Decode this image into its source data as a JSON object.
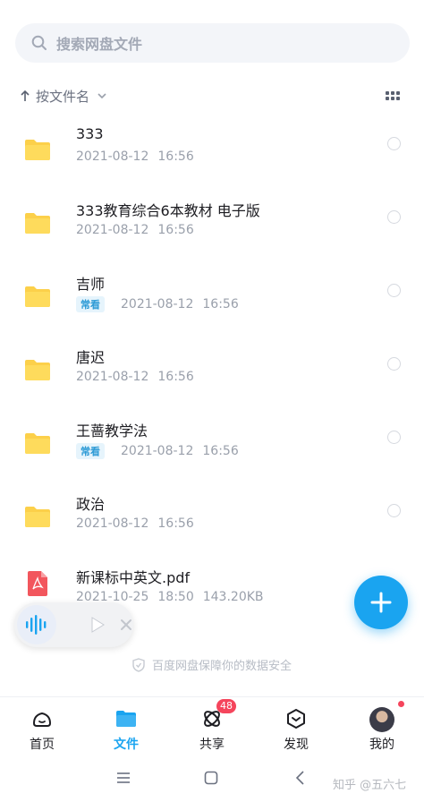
{
  "search": {
    "placeholder": "搜索网盘文件",
    "icon": "search-icon"
  },
  "sort": {
    "label": "按文件名"
  },
  "files": [
    {
      "name": "333",
      "badge": "",
      "date": "2021-08-12",
      "time": "16:56",
      "size": "",
      "type": "folder"
    },
    {
      "name": "333教育综合6本教材 电子版",
      "badge": "",
      "date": "2021-08-12",
      "time": "16:56",
      "size": "",
      "type": "folder"
    },
    {
      "name": "吉师",
      "badge": "常看",
      "date": "2021-08-12",
      "time": "16:56",
      "size": "",
      "type": "folder"
    },
    {
      "name": "唐迟",
      "badge": "",
      "date": "2021-08-12",
      "time": "16:56",
      "size": "",
      "type": "folder"
    },
    {
      "name": "王蔷教学法",
      "badge": "常看",
      "date": "2021-08-12",
      "time": "16:56",
      "size": "",
      "type": "folder"
    },
    {
      "name": "政治",
      "badge": "",
      "date": "2021-08-12",
      "time": "16:56",
      "size": "",
      "type": "folder"
    },
    {
      "name": "新课标中英文.pdf",
      "badge": "",
      "date": "2021-10-25",
      "time": "18:50",
      "size": "143.20KB",
      "type": "pdf"
    }
  ],
  "safety_notice": "百度网盘保障你的数据安全",
  "tabs": [
    {
      "label": "首页",
      "icon": "home-icon"
    },
    {
      "label": "文件",
      "icon": "folder-icon"
    },
    {
      "label": "共享",
      "icon": "share-icon",
      "count": "48"
    },
    {
      "label": "发现",
      "icon": "discover-icon"
    },
    {
      "label": "我的",
      "icon": "avatar"
    }
  ],
  "watermark": "知乎 @五六七",
  "colors": {
    "accent": "#1aa4f0",
    "folder": "#fcd04a",
    "badge_red": "#f5455c",
    "pdf_red": "#f2565d"
  }
}
